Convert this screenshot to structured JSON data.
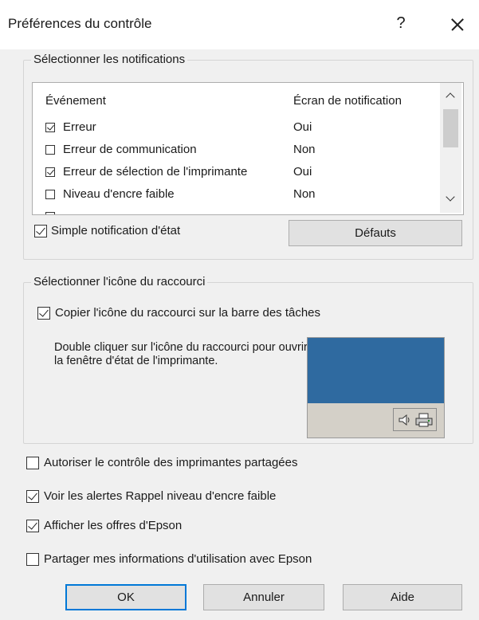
{
  "window": {
    "title": "Préférences du contrôle",
    "help_label": "?"
  },
  "notifications": {
    "group_label": "Sélectionner les notifications",
    "columns": [
      "Événement",
      "Écran de notification"
    ],
    "rows": [
      {
        "event": "Erreur",
        "screen": "Oui",
        "checked": true
      },
      {
        "event": "Erreur de communication",
        "screen": "Non",
        "checked": false
      },
      {
        "event": "Erreur de sélection de l'imprimante",
        "screen": "Oui",
        "checked": true
      },
      {
        "event": "Niveau d'encre faible",
        "screen": "Non",
        "checked": false
      }
    ],
    "simple_notification_label": "Simple notification d'état",
    "simple_notification_checked": true,
    "defaults_button": "Défauts"
  },
  "shortcut": {
    "group_label": "Sélectionner l'icône du raccourci",
    "copy_label": "Copier l'icône du raccourci sur la barre des tâches",
    "copy_checked": true,
    "description": "Double cliquer sur l'icône du raccourci pour ouvrir la fenêtre d'état de l'imprimante."
  },
  "options": [
    {
      "label": "Autoriser le contrôle des imprimantes partagées",
      "checked": false
    },
    {
      "label": "Voir les alertes Rappel niveau d'encre faible",
      "checked": true
    },
    {
      "label": "Afficher les offres d'Epson",
      "checked": true
    },
    {
      "label": "Partager mes informations d'utilisation avec Epson",
      "checked": false
    }
  ],
  "buttons": {
    "ok": "OK",
    "cancel": "Annuler",
    "help": "Aide"
  },
  "colors": {
    "preview_desktop": "#2f6aa0",
    "default_button_border": "#0078d7"
  }
}
